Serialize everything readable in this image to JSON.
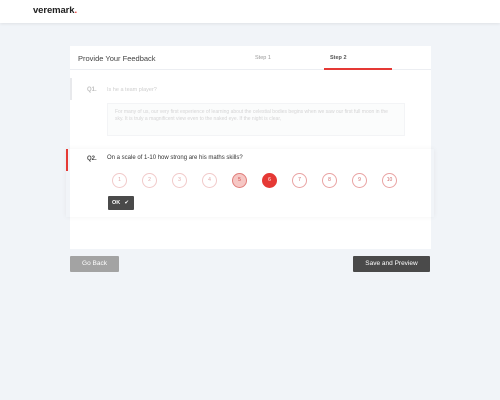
{
  "brand": {
    "name": "veremark",
    "dot": "."
  },
  "form": {
    "title": "Provide Your Feedback",
    "steps": [
      {
        "label": "Step 1",
        "active": false
      },
      {
        "label": "Step 2",
        "active": true
      }
    ],
    "accent": "#e53935"
  },
  "questions": {
    "q1": {
      "number": "Q1.",
      "text": "Is he a team player?",
      "answer": "For many of us, our very first experience of learning about the celestial bodies begins when we saw our first full moon in the sky. It is truly a magnificent view even to the naked eye. If the night is clear,"
    },
    "q2": {
      "number": "Q2.",
      "text": "On a scale of 1-10 how strong are his maths skills?",
      "scale": [
        "1",
        "2",
        "3",
        "4",
        "5",
        "6",
        "7",
        "8",
        "9",
        "10"
      ],
      "selected": "6",
      "ok_label": "OK",
      "ok_icon": "check-icon"
    }
  },
  "actions": {
    "back_label": "Go Back",
    "save_label": "Save and Preview"
  }
}
